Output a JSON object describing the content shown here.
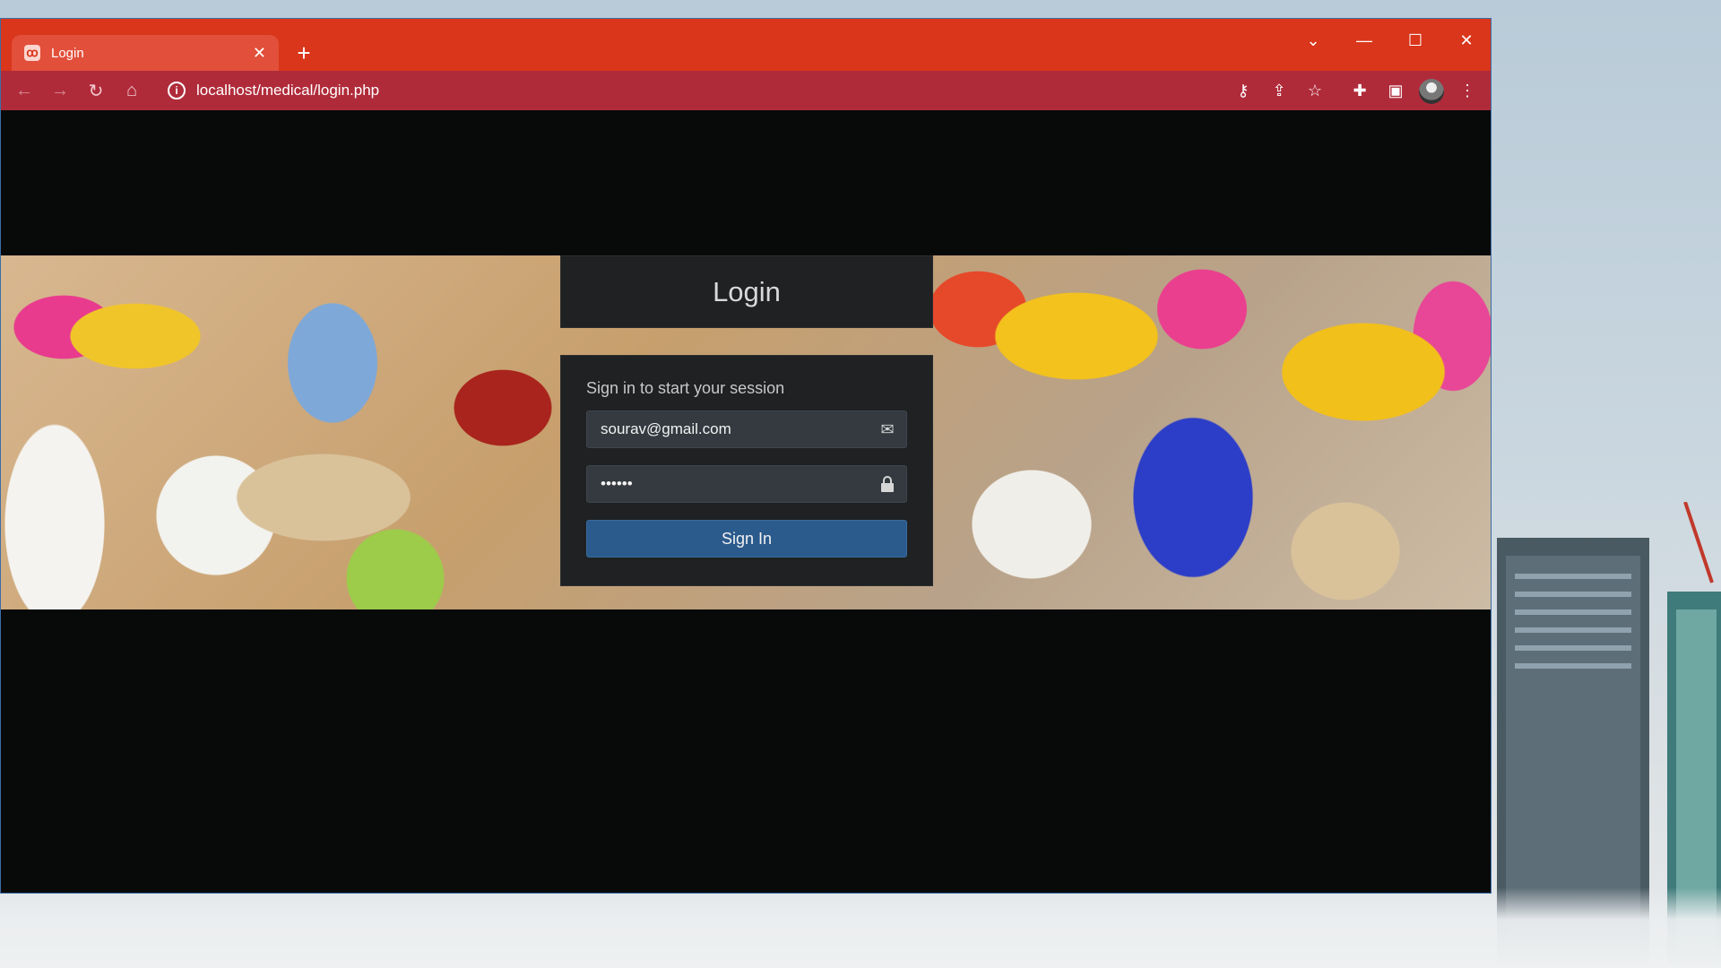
{
  "browser": {
    "tab": {
      "title": "Login",
      "favicon_icon": "xampp-icon",
      "close_icon": "close-icon"
    },
    "new_tab_icon": "plus-icon",
    "window_controls": {
      "tab_search": "chevron-down-icon",
      "minimize": "minimize-icon",
      "maximize": "maximize-icon",
      "close": "close-icon"
    },
    "toolbar": {
      "back_icon": "back-arrow-icon",
      "forward_icon": "forward-arrow-icon",
      "reload_icon": "reload-icon",
      "home_icon": "home-icon",
      "site_info_icon": "info-icon",
      "url": "localhost/medical/login.php",
      "right_icons": [
        "key-icon",
        "share-icon",
        "star-icon",
        "extensions-icon",
        "side-panel-icon",
        "avatar",
        "more-menu-icon"
      ]
    },
    "colors": {
      "tab_bar": "#d9361b",
      "toolbar": "#b02b3a",
      "page_bg": "#080a0a"
    }
  },
  "login": {
    "title": "Login",
    "message": "Sign in to start your session",
    "email": {
      "value": "sourav@gmail.com",
      "icon": "envelope-icon"
    },
    "password": {
      "value": "••••••",
      "icon": "lock-icon"
    },
    "submit_label": "Sign In",
    "colors": {
      "card": "#1f2122",
      "input": "#343a40",
      "button": "#2b5a8c"
    }
  }
}
